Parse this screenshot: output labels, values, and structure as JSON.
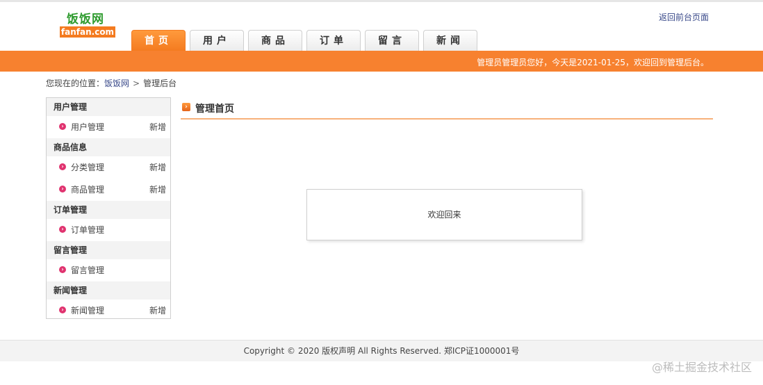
{
  "header": {
    "logo_cn": "饭饭网",
    "logo_en": "fanfan.com",
    "return_link": "返回前台页面",
    "tabs": [
      "首页",
      "用户",
      "商品",
      "订单",
      "留言",
      "新闻"
    ],
    "active_tab": 0
  },
  "bar": {
    "text": "管理员管理员您好，今天是2021-01-25，欢迎回到管理后台。"
  },
  "breadcrumb": {
    "prefix": "您现在的位置：",
    "home": "饭饭网",
    "separator": ">",
    "current": "管理后台"
  },
  "sidebar": {
    "groups": [
      {
        "title": "用户管理",
        "items": [
          {
            "label": "用户管理",
            "action": "新增"
          }
        ]
      },
      {
        "title": "商品信息",
        "items": [
          {
            "label": "分类管理",
            "action": "新增"
          },
          {
            "label": "商品管理",
            "action": "新增"
          }
        ]
      },
      {
        "title": "订单管理",
        "items": [
          {
            "label": "订单管理",
            "action": ""
          }
        ]
      },
      {
        "title": "留言管理",
        "items": [
          {
            "label": "留言管理",
            "action": ""
          }
        ]
      },
      {
        "title": "新闻管理",
        "items": [
          {
            "label": "新闻管理",
            "action": "新增"
          }
        ]
      }
    ]
  },
  "main": {
    "title": "管理首页",
    "welcome": "欢迎回来"
  },
  "footer": {
    "text": "Copyright © 2020 版权声明 All Rights Reserved. 郑ICP证1000001号"
  },
  "watermark": "@稀土掘金技术社区",
  "colors": {
    "accent": "#f7812f",
    "logo_green": "#2e9b2e",
    "bullet": "#e0336f",
    "link": "#3a4a8a"
  }
}
